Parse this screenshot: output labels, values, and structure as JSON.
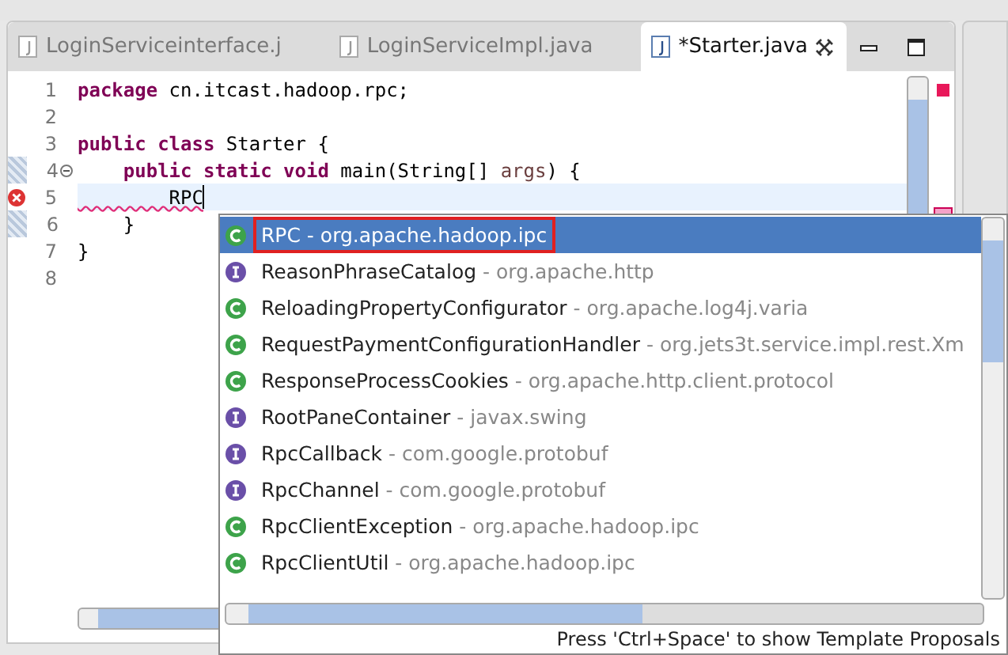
{
  "tabs": [
    {
      "label": "LoginServiceinterface.j",
      "selected": false
    },
    {
      "label": "LoginServiceImpl.java",
      "selected": false
    },
    {
      "label": "*Starter.java",
      "selected": true
    }
  ],
  "code_lines": [
    {
      "number": "1",
      "segments": [
        {
          "text": "package",
          "kind": "keyword"
        },
        {
          "text": " cn.itcast.hadoop.rpc;",
          "kind": "plain"
        }
      ]
    },
    {
      "number": "2"
    },
    {
      "number": "3",
      "segments": [
        {
          "text": "public class",
          "kind": "keyword"
        },
        {
          "text": " Starter {",
          "kind": "plain"
        }
      ]
    },
    {
      "number": "4",
      "folding": true,
      "changed": true,
      "segments": [
        {
          "text": "    public static void",
          "kind": "keyword"
        },
        {
          "text": " main(String[] ",
          "kind": "plain"
        },
        {
          "text": "args",
          "kind": "param"
        },
        {
          "text": ") {",
          "kind": "plain"
        }
      ]
    },
    {
      "number": "5",
      "error": true,
      "current": true,
      "segments": [
        {
          "text": "        RPC",
          "kind": "plain"
        }
      ]
    },
    {
      "number": "6",
      "changed": true,
      "segments": [
        {
          "text": "    }",
          "kind": "plain"
        }
      ]
    },
    {
      "number": "7",
      "segments": [
        {
          "text": "}",
          "kind": "plain"
        }
      ]
    },
    {
      "number": "8"
    }
  ],
  "proposals": [
    {
      "name": "RPC",
      "separator": " - ",
      "package": "org.apache.hadoop.ipc",
      "kind": "class",
      "selected": true
    },
    {
      "name": "ReasonPhraseCatalog",
      "separator": " - ",
      "package": "org.apache.http",
      "kind": "interface",
      "selected": false
    },
    {
      "name": "ReloadingPropertyConfigurator",
      "separator": " - ",
      "package": "org.apache.log4j.varia",
      "kind": "class",
      "selected": false
    },
    {
      "name": "RequestPaymentConfigurationHandler",
      "separator": " - ",
      "package": "org.jets3t.service.impl.rest.Xm",
      "kind": "class",
      "selected": false
    },
    {
      "name": "ResponseProcessCookies",
      "separator": " - ",
      "package": "org.apache.http.client.protocol",
      "kind": "class",
      "selected": false
    },
    {
      "name": "RootPaneContainer",
      "separator": " - ",
      "package": "javax.swing",
      "kind": "interface",
      "selected": false
    },
    {
      "name": "RpcCallback",
      "separator": " - ",
      "package": "com.google.protobuf",
      "kind": "interface",
      "selected": false
    },
    {
      "name": "RpcChannel",
      "separator": " - ",
      "package": "com.google.protobuf",
      "kind": "interface",
      "selected": false
    },
    {
      "name": "RpcClientException",
      "separator": " - ",
      "package": "org.apache.hadoop.ipc",
      "kind": "class",
      "selected": false
    },
    {
      "name": "RpcClientUtil",
      "separator": " - ",
      "package": "org.apache.hadoop.ipc",
      "kind": "class",
      "selected": false
    }
  ],
  "popup_status": "Press 'Ctrl+Space' to show Template Proposals"
}
